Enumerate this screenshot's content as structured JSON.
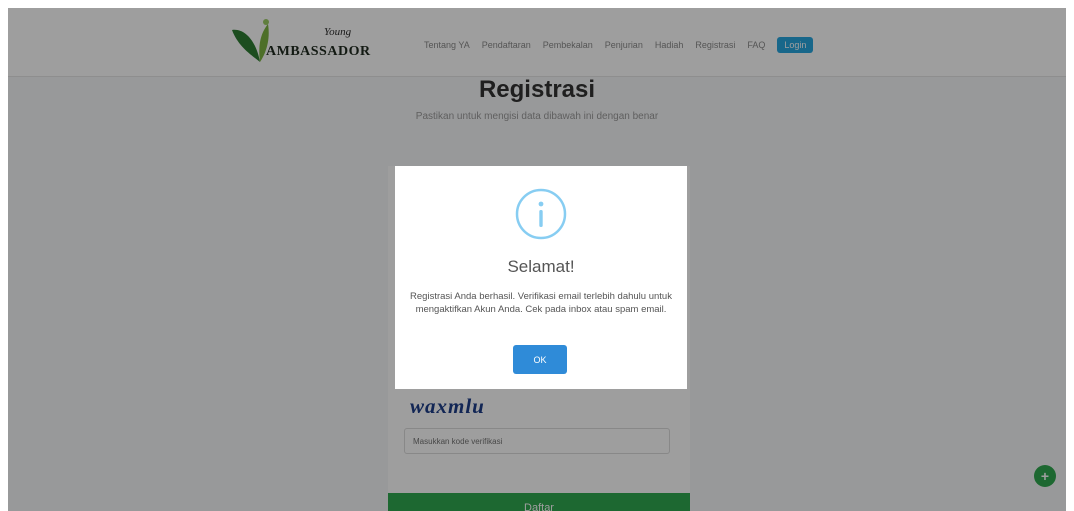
{
  "brand": {
    "logo_text": "AMBASSADOR",
    "logo_script": "Young"
  },
  "nav": {
    "items": [
      "Tentang YA",
      "Pendaftaran",
      "Pembekalan",
      "Penjurian",
      "Hadiah",
      "Registrasi",
      "FAQ"
    ],
    "login_label": "Login"
  },
  "page": {
    "title": "Registrasi",
    "subtitle": "Pastikan untuk mengisi data dibawah ini dengan benar"
  },
  "form": {
    "captcha_text": "waxmlu",
    "verification_placeholder": "Masukkan kode verifikasi",
    "submit_label": "Daftar"
  },
  "modal": {
    "title": "Selamat!",
    "message": "Registrasi Anda berhasil. Verifikasi email terlebih dahulu untuk mengaktifkan Akun Anda. Cek pada inbox atau spam email.",
    "ok_label": "OK"
  },
  "chat": {
    "icon": "chat-icon",
    "symbol": "+"
  },
  "colors": {
    "accent_blue": "#2f8bd8",
    "info_icon": "#87cdf2",
    "submit_green": "#2fa84f",
    "login_blue": "#27a6df"
  }
}
